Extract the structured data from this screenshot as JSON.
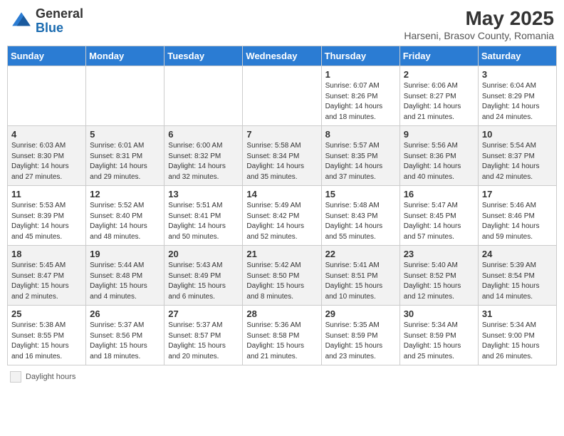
{
  "header": {
    "logo_general": "General",
    "logo_blue": "Blue",
    "title": "May 2025",
    "subtitle": "Harseni, Brasov County, Romania"
  },
  "calendar": {
    "days_of_week": [
      "Sunday",
      "Monday",
      "Tuesday",
      "Wednesday",
      "Thursday",
      "Friday",
      "Saturday"
    ],
    "weeks": [
      [
        {
          "day": "",
          "info": ""
        },
        {
          "day": "",
          "info": ""
        },
        {
          "day": "",
          "info": ""
        },
        {
          "day": "",
          "info": ""
        },
        {
          "day": "1",
          "info": "Sunrise: 6:07 AM\nSunset: 8:26 PM\nDaylight: 14 hours and 18 minutes."
        },
        {
          "day": "2",
          "info": "Sunrise: 6:06 AM\nSunset: 8:27 PM\nDaylight: 14 hours and 21 minutes."
        },
        {
          "day": "3",
          "info": "Sunrise: 6:04 AM\nSunset: 8:29 PM\nDaylight: 14 hours and 24 minutes."
        }
      ],
      [
        {
          "day": "4",
          "info": "Sunrise: 6:03 AM\nSunset: 8:30 PM\nDaylight: 14 hours and 27 minutes."
        },
        {
          "day": "5",
          "info": "Sunrise: 6:01 AM\nSunset: 8:31 PM\nDaylight: 14 hours and 29 minutes."
        },
        {
          "day": "6",
          "info": "Sunrise: 6:00 AM\nSunset: 8:32 PM\nDaylight: 14 hours and 32 minutes."
        },
        {
          "day": "7",
          "info": "Sunrise: 5:58 AM\nSunset: 8:34 PM\nDaylight: 14 hours and 35 minutes."
        },
        {
          "day": "8",
          "info": "Sunrise: 5:57 AM\nSunset: 8:35 PM\nDaylight: 14 hours and 37 minutes."
        },
        {
          "day": "9",
          "info": "Sunrise: 5:56 AM\nSunset: 8:36 PM\nDaylight: 14 hours and 40 minutes."
        },
        {
          "day": "10",
          "info": "Sunrise: 5:54 AM\nSunset: 8:37 PM\nDaylight: 14 hours and 42 minutes."
        }
      ],
      [
        {
          "day": "11",
          "info": "Sunrise: 5:53 AM\nSunset: 8:39 PM\nDaylight: 14 hours and 45 minutes."
        },
        {
          "day": "12",
          "info": "Sunrise: 5:52 AM\nSunset: 8:40 PM\nDaylight: 14 hours and 48 minutes."
        },
        {
          "day": "13",
          "info": "Sunrise: 5:51 AM\nSunset: 8:41 PM\nDaylight: 14 hours and 50 minutes."
        },
        {
          "day": "14",
          "info": "Sunrise: 5:49 AM\nSunset: 8:42 PM\nDaylight: 14 hours and 52 minutes."
        },
        {
          "day": "15",
          "info": "Sunrise: 5:48 AM\nSunset: 8:43 PM\nDaylight: 14 hours and 55 minutes."
        },
        {
          "day": "16",
          "info": "Sunrise: 5:47 AM\nSunset: 8:45 PM\nDaylight: 14 hours and 57 minutes."
        },
        {
          "day": "17",
          "info": "Sunrise: 5:46 AM\nSunset: 8:46 PM\nDaylight: 14 hours and 59 minutes."
        }
      ],
      [
        {
          "day": "18",
          "info": "Sunrise: 5:45 AM\nSunset: 8:47 PM\nDaylight: 15 hours and 2 minutes."
        },
        {
          "day": "19",
          "info": "Sunrise: 5:44 AM\nSunset: 8:48 PM\nDaylight: 15 hours and 4 minutes."
        },
        {
          "day": "20",
          "info": "Sunrise: 5:43 AM\nSunset: 8:49 PM\nDaylight: 15 hours and 6 minutes."
        },
        {
          "day": "21",
          "info": "Sunrise: 5:42 AM\nSunset: 8:50 PM\nDaylight: 15 hours and 8 minutes."
        },
        {
          "day": "22",
          "info": "Sunrise: 5:41 AM\nSunset: 8:51 PM\nDaylight: 15 hours and 10 minutes."
        },
        {
          "day": "23",
          "info": "Sunrise: 5:40 AM\nSunset: 8:52 PM\nDaylight: 15 hours and 12 minutes."
        },
        {
          "day": "24",
          "info": "Sunrise: 5:39 AM\nSunset: 8:54 PM\nDaylight: 15 hours and 14 minutes."
        }
      ],
      [
        {
          "day": "25",
          "info": "Sunrise: 5:38 AM\nSunset: 8:55 PM\nDaylight: 15 hours and 16 minutes."
        },
        {
          "day": "26",
          "info": "Sunrise: 5:37 AM\nSunset: 8:56 PM\nDaylight: 15 hours and 18 minutes."
        },
        {
          "day": "27",
          "info": "Sunrise: 5:37 AM\nSunset: 8:57 PM\nDaylight: 15 hours and 20 minutes."
        },
        {
          "day": "28",
          "info": "Sunrise: 5:36 AM\nSunset: 8:58 PM\nDaylight: 15 hours and 21 minutes."
        },
        {
          "day": "29",
          "info": "Sunrise: 5:35 AM\nSunset: 8:59 PM\nDaylight: 15 hours and 23 minutes."
        },
        {
          "day": "30",
          "info": "Sunrise: 5:34 AM\nSunset: 8:59 PM\nDaylight: 15 hours and 25 minutes."
        },
        {
          "day": "31",
          "info": "Sunrise: 5:34 AM\nSunset: 9:00 PM\nDaylight: 15 hours and 26 minutes."
        }
      ]
    ]
  },
  "footer": {
    "note": "Daylight hours"
  }
}
